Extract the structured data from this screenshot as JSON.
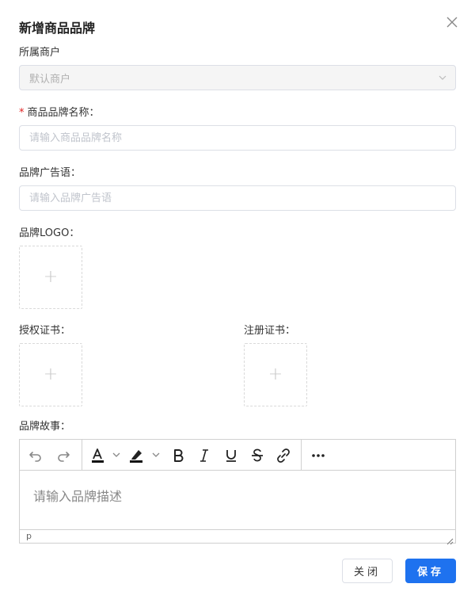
{
  "dialog": {
    "title": "新增商品品牌"
  },
  "merchant": {
    "label": "所属商户",
    "value": "默认商户"
  },
  "brand_name": {
    "label": "商品品牌名称：",
    "required_mark": "*",
    "placeholder": "请输入商品品牌名称"
  },
  "slogan": {
    "label": "品牌广告语：",
    "placeholder": "请输入品牌广告语"
  },
  "logo": {
    "label": "品牌LOGO：",
    "plus": "+"
  },
  "license": {
    "label": "授权证书：",
    "plus": "+"
  },
  "registration": {
    "label": "注册证书：",
    "plus": "+"
  },
  "story": {
    "label": "品牌故事：",
    "placeholder": "请输入品牌描述",
    "status_path": "p",
    "toolbar_icons": [
      "undo-icon",
      "redo-icon",
      "text-color-icon",
      "highlight-icon",
      "bold-icon",
      "italic-icon",
      "underline-icon",
      "strikethrough-icon",
      "link-icon",
      "more-icon"
    ]
  },
  "footer": {
    "cancel_label": "关闭",
    "save_label": "保存"
  },
  "colors": {
    "primary": "#1e72ef",
    "required": "#e02020"
  }
}
